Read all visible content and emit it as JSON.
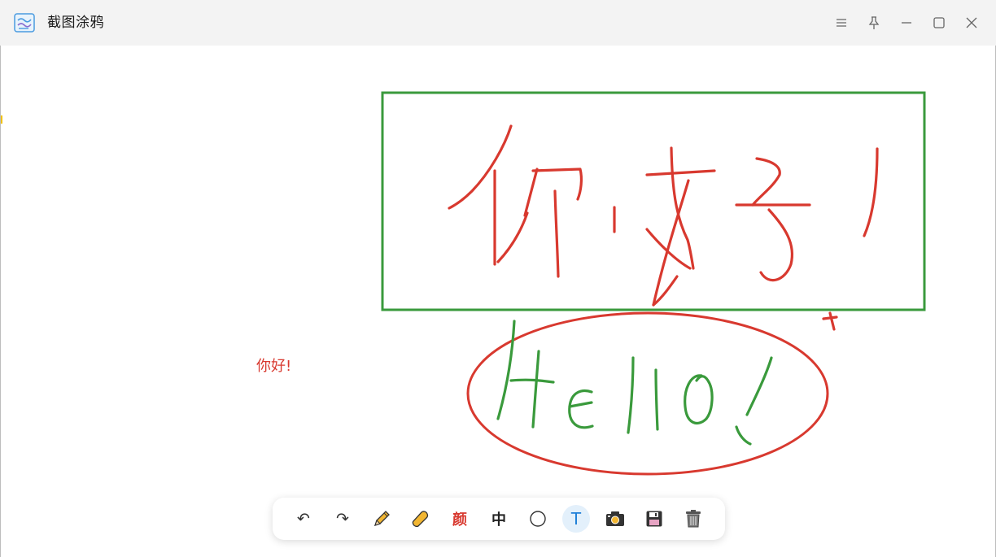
{
  "window": {
    "title": "截图涂鸦",
    "controls": [
      "menu-icon",
      "pin-icon",
      "minimize-icon",
      "maximize-icon",
      "close-icon"
    ]
  },
  "canvas": {
    "text_annotation": "你好!",
    "handwriting": {
      "chinese": "你好!",
      "english": "Hello!"
    },
    "colors": {
      "red_ink": "#d8392f",
      "green_ink": "#3a9a3c",
      "rectangle": "#3a9a3c",
      "ellipse": "#d8392f"
    }
  },
  "toolbar": {
    "tools": [
      {
        "name": "undo",
        "icon": "undo-icon",
        "label": "↶"
      },
      {
        "name": "redo",
        "icon": "redo-icon",
        "label": "↷"
      },
      {
        "name": "pencil",
        "icon": "pencil-icon",
        "label": ""
      },
      {
        "name": "eraser",
        "icon": "eraser-icon",
        "label": ""
      },
      {
        "name": "color",
        "icon": "color-text-icon",
        "label": "颜"
      },
      {
        "name": "size",
        "icon": "size-text-icon",
        "label": "中"
      },
      {
        "name": "ellipse",
        "icon": "circle-icon",
        "label": ""
      },
      {
        "name": "text",
        "icon": "text-icon",
        "label": "T",
        "active": true
      },
      {
        "name": "screenshot",
        "icon": "camera-icon",
        "label": ""
      },
      {
        "name": "save",
        "icon": "floppy-icon",
        "label": ""
      },
      {
        "name": "clear",
        "icon": "trash-icon",
        "label": ""
      }
    ]
  }
}
